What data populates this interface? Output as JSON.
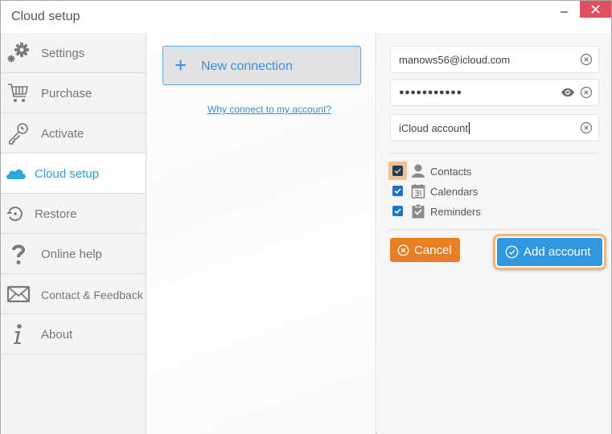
{
  "window": {
    "title": "Cloud setup",
    "close_label": "×",
    "colors": {
      "close": "#e0505f",
      "accent": "#2e9fd8"
    }
  },
  "sidebar": {
    "active": "cloud-setup",
    "items": [
      {
        "id": "settings",
        "label": "Settings",
        "icon": "gears-icon"
      },
      {
        "id": "purchase",
        "label": "Purchase",
        "icon": "cart-icon"
      },
      {
        "id": "activate",
        "label": "Activate",
        "icon": "key-icon"
      },
      {
        "id": "cloud-setup",
        "label": "Cloud setup",
        "icon": "cloud-icon"
      },
      {
        "id": "restore",
        "label": "Restore",
        "icon": "restore-icon"
      },
      {
        "id": "online-help",
        "label": "Online help",
        "icon": "question-icon"
      },
      {
        "id": "contact",
        "label": "Contact & Feedback",
        "icon": "envelope-icon"
      },
      {
        "id": "about",
        "label": "About",
        "icon": "info-icon"
      }
    ]
  },
  "middle": {
    "new_connection": {
      "icon": "+",
      "label": "New connection"
    },
    "why_link": "Why connect to my account?"
  },
  "form": {
    "email": {
      "value": "manows56@icloud.com"
    },
    "password": {
      "value": "●●●●●●●●●●●"
    },
    "account_name": {
      "value": "iCloud account"
    },
    "options": [
      {
        "label": "Contacts",
        "checked": true,
        "icon": "person-icon",
        "focused": true
      },
      {
        "label": "Calendars",
        "checked": true,
        "icon": "calendar-icon",
        "focused": false
      },
      {
        "label": "Reminders",
        "checked": true,
        "icon": "clipboard-check-icon",
        "focused": false
      }
    ],
    "cancel_label": "Cancel",
    "add_label": "Add account",
    "colors": {
      "cancel": "#e87f22",
      "add": "#2f98de",
      "focus_ring": "#f2b67b",
      "checkbox": "#1b74c8"
    }
  }
}
